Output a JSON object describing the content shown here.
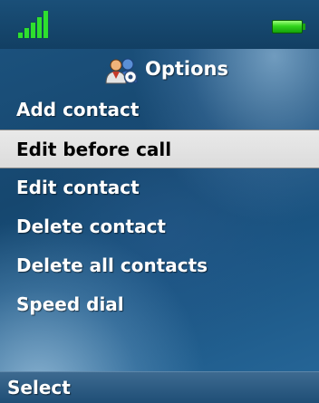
{
  "status_bar": {
    "signal_icon": "signal-strength-icon",
    "battery_icon": "battery-icon",
    "colors": {
      "signal": "#2ee02e",
      "battery": "#31d41c"
    }
  },
  "header": {
    "icon": "contacts-options-icon",
    "title": "Options"
  },
  "menu": {
    "items": [
      {
        "label": "Add contact",
        "selected": false
      },
      {
        "label": "Edit before call",
        "selected": true
      },
      {
        "label": "Edit contact",
        "selected": false
      },
      {
        "label": "Delete contact",
        "selected": false
      },
      {
        "label": "Delete all contacts",
        "selected": false
      },
      {
        "label": "Speed dial",
        "selected": false
      }
    ]
  },
  "softkeys": {
    "left": "Select"
  },
  "colors": {
    "background": "#1a5482",
    "highlight": "#e2e2e2",
    "text": "#ffffff",
    "selected_text": "#000000"
  }
}
